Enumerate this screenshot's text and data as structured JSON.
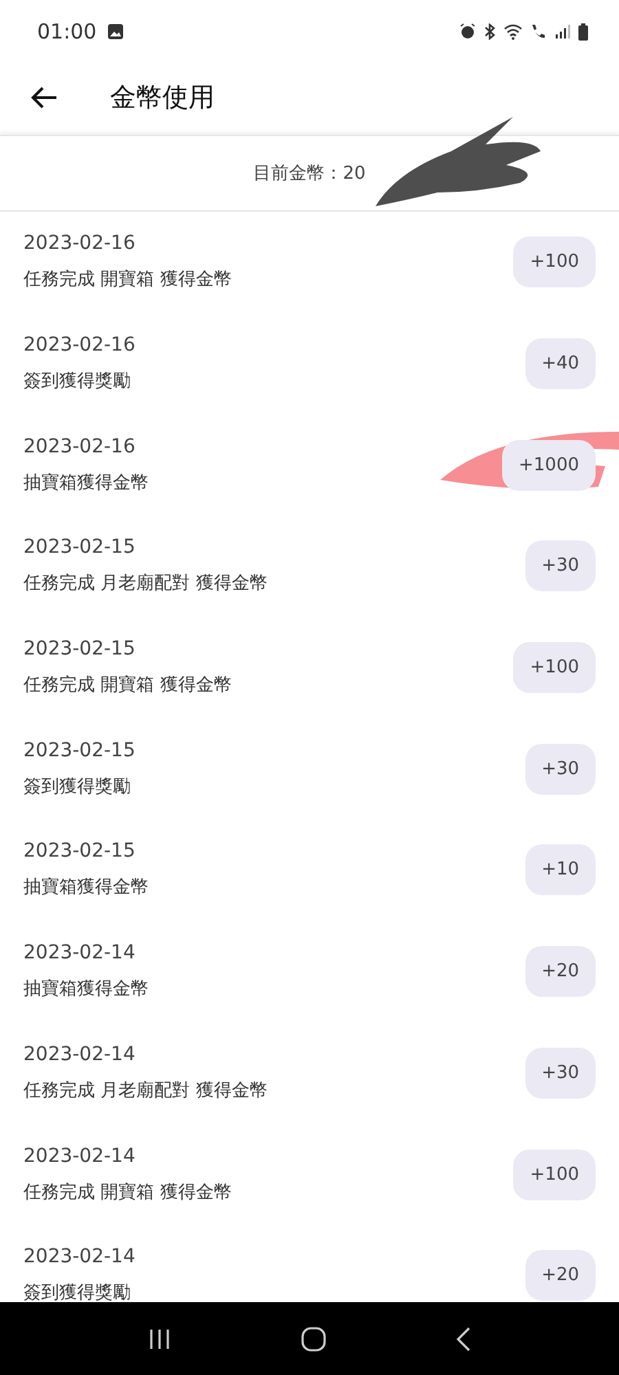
{
  "status_bar": {
    "time": "01:00"
  },
  "app_bar": {
    "title": "金幣使用"
  },
  "balance": {
    "text": "目前金幣：20"
  },
  "records": [
    {
      "date": "2023-02-16",
      "description": "任務完成 開寶箱 獲得金幣",
      "amount": "+100"
    },
    {
      "date": "2023-02-16",
      "description": "簽到獲得獎勵",
      "amount": "+40"
    },
    {
      "date": "2023-02-16",
      "description": "抽寶箱獲得金幣",
      "amount": "+1000"
    },
    {
      "date": "2023-02-15",
      "description": "任務完成 月老廟配對 獲得金幣",
      "amount": "+30"
    },
    {
      "date": "2023-02-15",
      "description": "任務完成 開寶箱 獲得金幣",
      "amount": "+100"
    },
    {
      "date": "2023-02-15",
      "description": "簽到獲得獎勵",
      "amount": "+30"
    },
    {
      "date": "2023-02-15",
      "description": "抽寶箱獲得金幣",
      "amount": "+10"
    },
    {
      "date": "2023-02-14",
      "description": "抽寶箱獲得金幣",
      "amount": "+20"
    },
    {
      "date": "2023-02-14",
      "description": "任務完成 月老廟配對 獲得金幣",
      "amount": "+30"
    },
    {
      "date": "2023-02-14",
      "description": "任務完成 開寶箱 獲得金幣",
      "amount": "+100"
    },
    {
      "date": "2023-02-14",
      "description": "簽到獲得獎勵",
      "amount": "+20"
    }
  ]
}
